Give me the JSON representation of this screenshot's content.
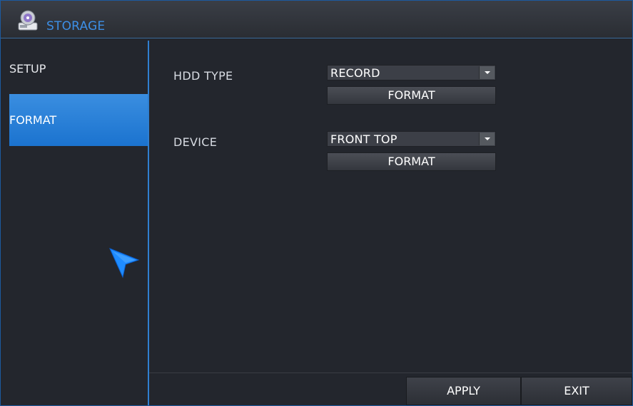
{
  "window": {
    "title": "STORAGE",
    "title_icon": "disk-drive-icon",
    "accent_color": "#2f7fd0"
  },
  "sidebar": {
    "items": [
      {
        "label": "SETUP",
        "selected": false
      },
      {
        "label": "FORMAT",
        "selected": true
      }
    ]
  },
  "main": {
    "hdd_type": {
      "label": "HDD TYPE",
      "selected": "RECORD",
      "format_label": "FORMAT"
    },
    "device": {
      "label": "DEVICE",
      "selected": "FRONT TOP",
      "format_label": "FORMAT"
    }
  },
  "footer": {
    "apply_label": "APPLY",
    "exit_label": "EXIT"
  },
  "icons": {
    "dropdown": "chevron-down-icon",
    "pointer": "mouse-pointer-icon"
  }
}
